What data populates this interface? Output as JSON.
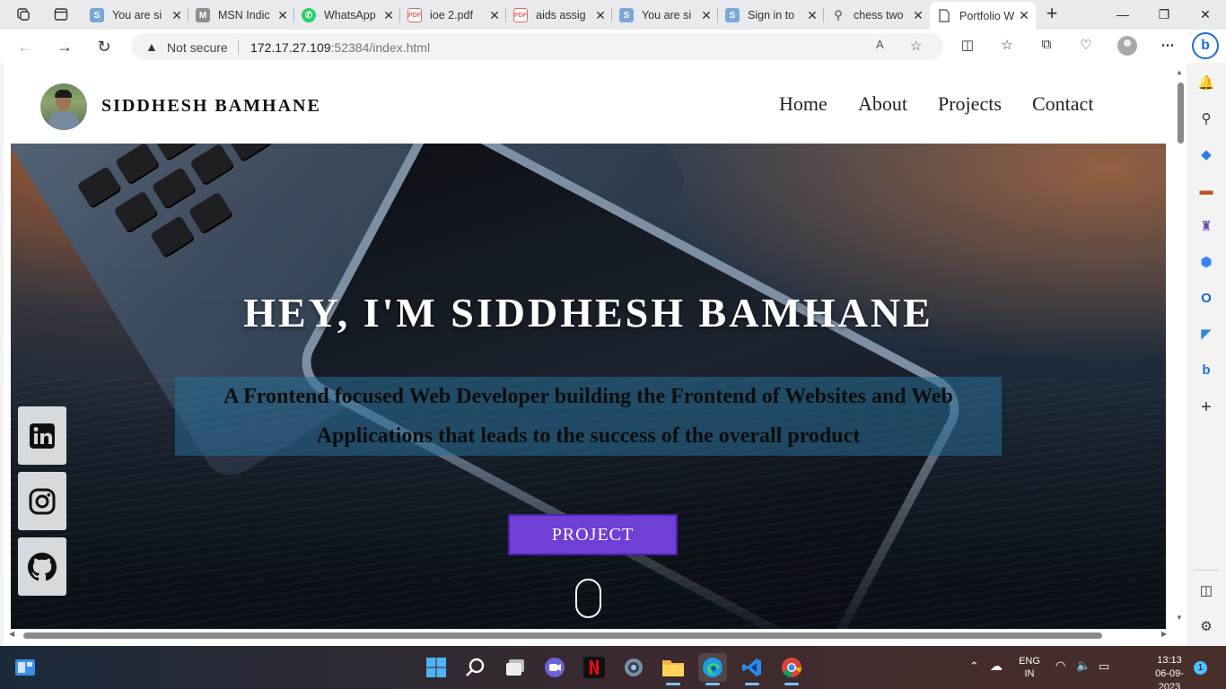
{
  "browser": {
    "tabs": [
      {
        "title": "You are si",
        "icon": "s-icon",
        "color": "#7aa7d8"
      },
      {
        "title": "MSN Indic",
        "icon": "msn-icon",
        "color": "#777777"
      },
      {
        "title": "WhatsApp",
        "icon": "whatsapp-icon",
        "color": "#25d366"
      },
      {
        "title": "ioe 2.pdf",
        "icon": "pdf-icon",
        "color": "#e06666"
      },
      {
        "title": "aids assig",
        "icon": "pdf-icon",
        "color": "#e06666"
      },
      {
        "title": "You are si",
        "icon": "s-icon",
        "color": "#7aa7d8"
      },
      {
        "title": "Sign in to",
        "icon": "s-icon",
        "color": "#7aa7d8"
      },
      {
        "title": "chess two",
        "icon": "search-icon",
        "color": "#777777"
      },
      {
        "title": "Portfolio W",
        "icon": "page-icon",
        "color": "#555555"
      }
    ],
    "address": {
      "security_label": "Not secure",
      "url_host": "172.17.27.109",
      "url_rest": ":52384/index.html"
    }
  },
  "site": {
    "brand": "SIDDHESH BAMHANE",
    "nav": [
      "Home",
      "About",
      "Projects",
      "Contact"
    ],
    "hero_title": "HEY, I'M SIDDHESH BAMHANE",
    "hero_subtitle_line1": "A Frontend focused Web Developer building the Frontend of Websites and Web",
    "hero_subtitle_line2": "Applications that leads to the success of the overall product",
    "cta_label": "PROJECT",
    "socials": [
      "linkedin-icon",
      "instagram-icon",
      "github-icon"
    ],
    "accent_color": "#6f3fd6"
  },
  "taskbar": {
    "lang_line1": "ENG",
    "lang_line2": "IN",
    "time": "13:13",
    "date": "06-09-2023",
    "notification_count": "1"
  }
}
